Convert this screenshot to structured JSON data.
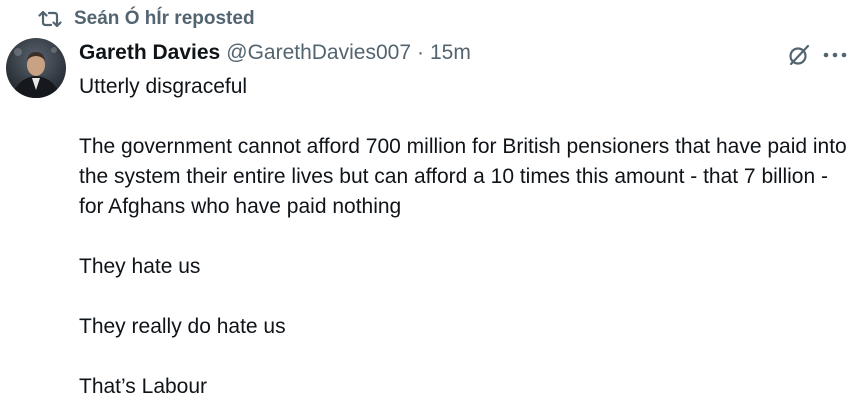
{
  "repost": {
    "icon": "repost-icon",
    "text": "Seán Ó hÍr reposted"
  },
  "post": {
    "avatar": "avatar-photo",
    "author": {
      "display_name": "Gareth Davies",
      "handle": "@GarethDavies007",
      "separator": "·",
      "time": "15m"
    },
    "icons": [
      "grok-icon",
      "more-icon"
    ],
    "paragraphs": [
      "Utterly disgraceful",
      "The government cannot afford 700 million  for British pensioners that have paid into the system their entire lives but can afford a 10 times this amount - that 7 billion - for Afghans who have paid nothing",
      "They hate us",
      "They really do hate us",
      "That’s Labour"
    ]
  },
  "colors": {
    "text_primary": "#0f1419",
    "text_secondary": "#536471",
    "background": "#ffffff"
  }
}
